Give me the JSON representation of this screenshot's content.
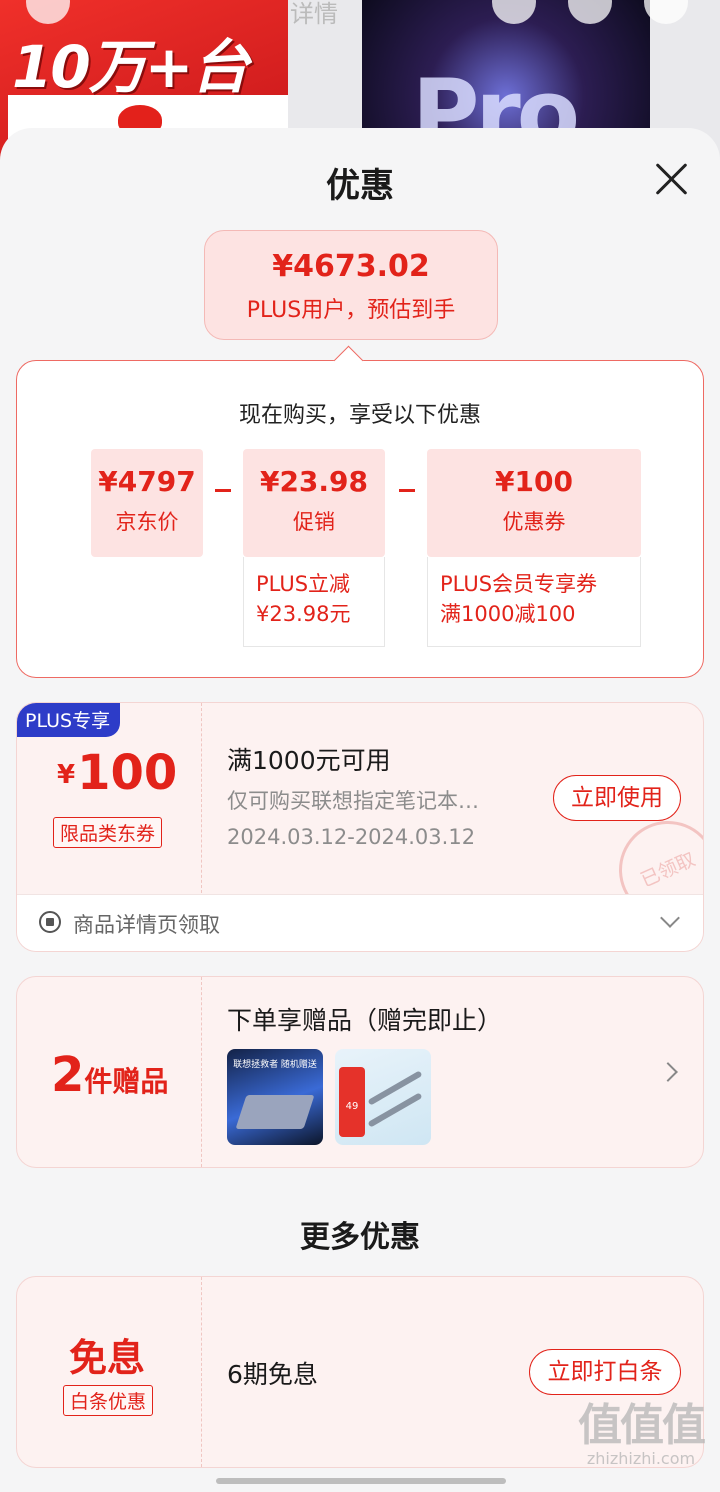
{
  "background": {
    "banner_text": "10万+台",
    "product_text": "Pro",
    "tab_text": "详情"
  },
  "sheet": {
    "title": "优惠"
  },
  "price_bubble": {
    "price": "¥4673.02",
    "note": "PLUS用户，预估到手"
  },
  "breakdown": {
    "title": "现在购买，享受以下优惠",
    "items": [
      {
        "value": "¥4797",
        "label": "京东价"
      },
      {
        "value": "¥23.98",
        "label": "促销",
        "note_line1": "PLUS立减",
        "note_line2": "¥23.98元"
      },
      {
        "value": "¥100",
        "label": "优惠券",
        "note_line1": "PLUS会员专享券",
        "note_line2": "满1000减100"
      }
    ]
  },
  "coupon": {
    "badge": "PLUS专享",
    "currency": "¥",
    "amount": "100",
    "type_tag": "限品类东券",
    "title": "满1000元可用",
    "description": "仅可购买联想指定笔记本…",
    "date_range": "2024.03.12-2024.03.12",
    "button": "立即使用",
    "stamp": "已领取",
    "footer": "商品详情页领取"
  },
  "gifts": {
    "count": "2",
    "count_label": "件赠品",
    "title": "下单享赠品（赠完即止）",
    "thumb1_caption": "联想拯救者 随机赠送",
    "thumb2_tag": "49"
  },
  "more": {
    "title": "更多优惠"
  },
  "installment": {
    "big": "免息",
    "tag": "白条优惠",
    "title": "6期免息",
    "button": "立即打白条"
  },
  "watermark": {
    "big": "值值值",
    "small": "zhizhizhi.com"
  }
}
